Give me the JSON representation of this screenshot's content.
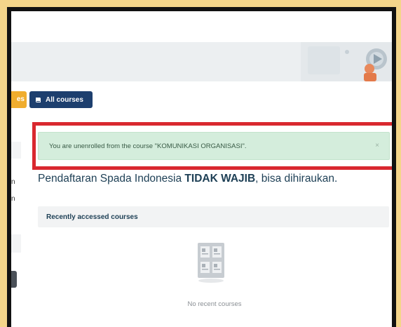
{
  "toolbar": {
    "partial_button_label": "es",
    "all_courses_label": "All courses"
  },
  "sidebar": {
    "text_lines": [
      "n",
      "n"
    ]
  },
  "alert": {
    "message": "You are unenrolled from the course \"KOMUNIKASI ORGANISASI\".",
    "close_label": "×"
  },
  "notice": {
    "prefix": "Pendaftaran Spada Indonesia ",
    "emphasis": "TIDAK WAJIB",
    "suffix": ", bisa dihiraukan."
  },
  "recent": {
    "title": "Recently accessed courses",
    "empty_text": "No recent courses"
  },
  "colors": {
    "annotation_box": "#d9282f",
    "alert_bg": "#d4eddc",
    "primary_button": "#1d3f6e",
    "warning_button": "#f0ad2e"
  }
}
